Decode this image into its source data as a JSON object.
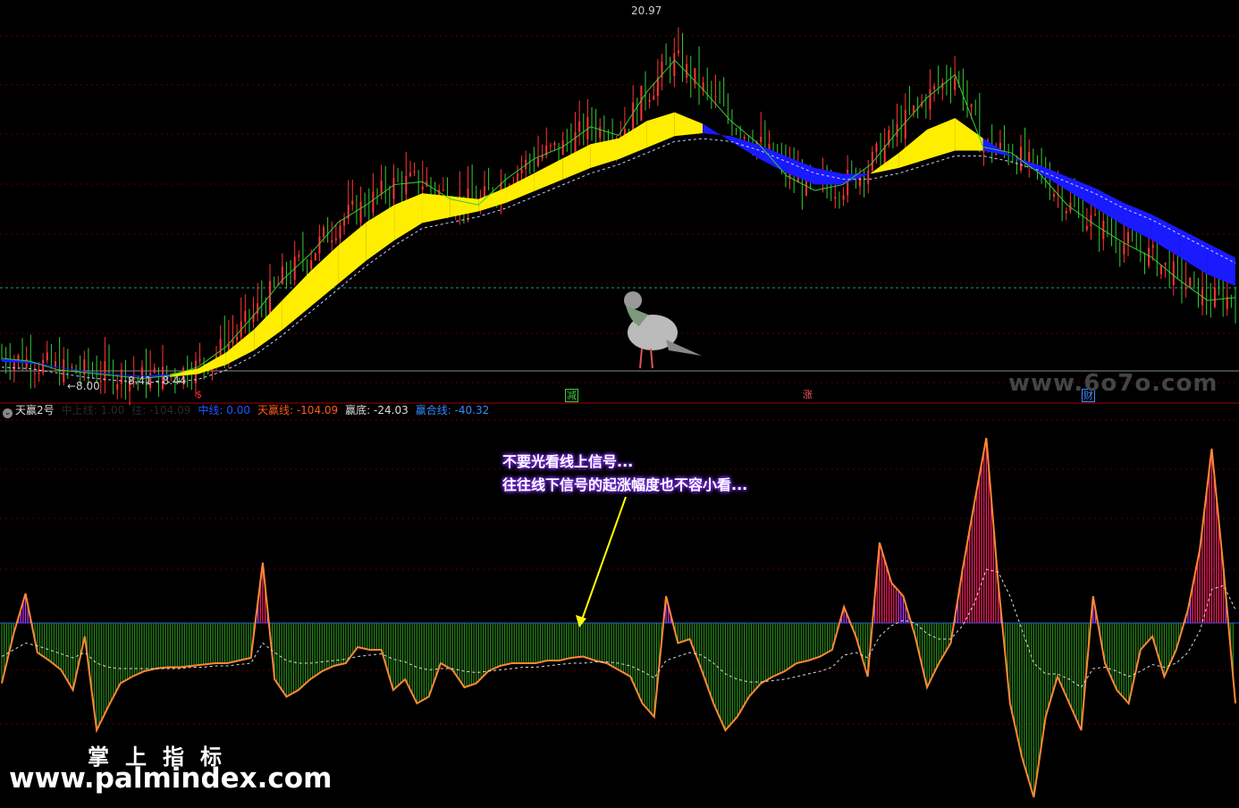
{
  "panel": {
    "title": "天赢2号",
    "legend": [
      {
        "label": "中上线: 1.00",
        "color": "#2a2a2a"
      },
      {
        "label": "往: -104.09",
        "color": "#2a2a2a"
      },
      {
        "label": "中线: 0.00",
        "color": "#2255ff"
      },
      {
        "label": "天赢线: -104.09",
        "color": "#ff5a1a"
      },
      {
        "label": "赢底: -24.03",
        "color": "#dddddd"
      },
      {
        "label": "赢合线: -40.32",
        "color": "#3388ff"
      }
    ]
  },
  "price_labels": {
    "high": "20.97",
    "low": "8.00",
    "range": "8.41 - 8.44"
  },
  "signals": [
    {
      "label": "$",
      "color": "#ff3333"
    },
    {
      "label": "减",
      "color": "#44cc44"
    },
    {
      "label": "涨",
      "color": "#ff5566"
    },
    {
      "label": "财",
      "color": "#4488ff"
    }
  ],
  "annotation": {
    "line1": "不要光看线上信号...",
    "line2": "往往线下信号的起涨幅度也不容小看..."
  },
  "watermarks": {
    "cn": "掌上指标",
    "url": "www.palmindex.com",
    "site": "www.6o7o.com"
  },
  "colors": {
    "up_candle": "#ff3333",
    "green_line": "#33cc33",
    "ribbon_up": "#ffee00",
    "ribbon_down": "#1a1aff",
    "hist_pos": "#cc33ff",
    "hist_neg": "#2a8a1a",
    "hot": "#ff2266",
    "orange_line": "#ff8833"
  },
  "chart_data": [
    {
      "type": "line",
      "title": "",
      "price_high": 20.97,
      "price_low": 8.0,
      "close": [
        8.9,
        8.8,
        8.5,
        8.4,
        8.3,
        8.2,
        8.3,
        8.6,
        9.3,
        10.4,
        11.6,
        12.5,
        13.6,
        14.2,
        14.9,
        15.0,
        14.4,
        14.2,
        15.1,
        15.8,
        16.2,
        16.9,
        16.6,
        18.1,
        19.2,
        18.2,
        17.1,
        16.3,
        15.2,
        14.7,
        14.9,
        15.6,
        16.8,
        17.9,
        18.7,
        16.2,
        16.0,
        15.3,
        14.2,
        13.5,
        12.9,
        12.4,
        11.6,
        10.9,
        11.0
      ],
      "ma_fast": [
        8.9,
        8.8,
        8.6,
        8.45,
        8.35,
        8.3,
        8.35,
        8.55,
        9.1,
        9.9,
        10.9,
        11.9,
        12.8,
        13.6,
        14.2,
        14.6,
        14.5,
        14.4,
        14.8,
        15.3,
        15.8,
        16.3,
        16.5,
        17.1,
        17.4,
        17.0,
        16.4,
        15.8,
        15.3,
        14.9,
        14.9,
        15.3,
        16.0,
        16.8,
        17.2,
        16.5,
        15.9,
        15.3,
        14.7,
        14.1,
        13.5,
        13.0,
        12.4,
        11.8,
        11.4
      ],
      "ma_slow": [
        8.9,
        8.85,
        8.7,
        8.55,
        8.45,
        8.38,
        8.38,
        8.48,
        8.8,
        9.3,
        10.0,
        10.8,
        11.6,
        12.4,
        13.1,
        13.7,
        13.9,
        14.1,
        14.4,
        14.8,
        15.2,
        15.6,
        15.9,
        16.3,
        16.7,
        16.8,
        16.7,
        16.4,
        16.0,
        15.6,
        15.4,
        15.4,
        15.6,
        15.9,
        16.2,
        16.2,
        16.0,
        15.7,
        15.3,
        14.9,
        14.4,
        14.0,
        13.5,
        13.0,
        12.5
      ]
    },
    {
      "type": "bar",
      "title": "",
      "ylim": [
        -120,
        160
      ],
      "histogram": [
        -45,
        -8,
        22,
        -22,
        -28,
        -35,
        -50,
        -10,
        -80,
        -62,
        -45,
        -40,
        -36,
        -34,
        -33,
        -33,
        -32,
        -31,
        -30,
        -30,
        -28,
        -26,
        45,
        -42,
        -55,
        -50,
        -42,
        -36,
        -32,
        -30,
        -18,
        -20,
        -20,
        -50,
        -42,
        -60,
        -55,
        -30,
        -35,
        -48,
        -45,
        -36,
        -32,
        -30,
        -30,
        -30,
        -28,
        -28,
        -26,
        -25,
        -28,
        -30,
        -35,
        -40,
        -60,
        -70,
        20,
        -15,
        -12,
        -35,
        -60,
        -80,
        -70,
        -55,
        -45,
        -40,
        -36,
        -30,
        -28,
        -25,
        -20,
        12,
        -10,
        -40,
        60,
        30,
        20,
        -10,
        -48,
        -30,
        -15,
        40,
        90,
        138,
        30,
        -60,
        -100,
        -130,
        -70,
        -40,
        -60,
        -80,
        20,
        -30,
        -50,
        -60,
        -20,
        -10,
        -40,
        -20,
        10,
        55,
        130,
        40,
        -60
      ],
      "signal_line": [
        -25,
        -20,
        -15,
        -17,
        -20,
        -23,
        -26,
        -22,
        -30,
        -33,
        -34,
        -34,
        -34,
        -34,
        -34,
        -34,
        -33,
        -33,
        -32,
        -32,
        -31,
        -30,
        -15,
        -22,
        -28,
        -30,
        -30,
        -29,
        -28,
        -27,
        -25,
        -24,
        -23,
        -27,
        -29,
        -33,
        -35,
        -34,
        -34,
        -36,
        -37,
        -36,
        -35,
        -34,
        -33,
        -33,
        -32,
        -31,
        -30,
        -30,
        -29,
        -29,
        -30,
        -32,
        -36,
        -41,
        -28,
        -25,
        -22,
        -24,
        -30,
        -38,
        -42,
        -44,
        -44,
        -43,
        -42,
        -40,
        -38,
        -36,
        -33,
        -24,
        -22,
        -26,
        -10,
        -2,
        2,
        0,
        -8,
        -12,
        -12,
        -2,
        15,
        40,
        38,
        20,
        -5,
        -30,
        -38,
        -38,
        -42,
        -48,
        -34,
        -33,
        -36,
        -40,
        -36,
        -31,
        -33,
        -30,
        -22,
        -6,
        25,
        28,
        10
      ]
    }
  ]
}
